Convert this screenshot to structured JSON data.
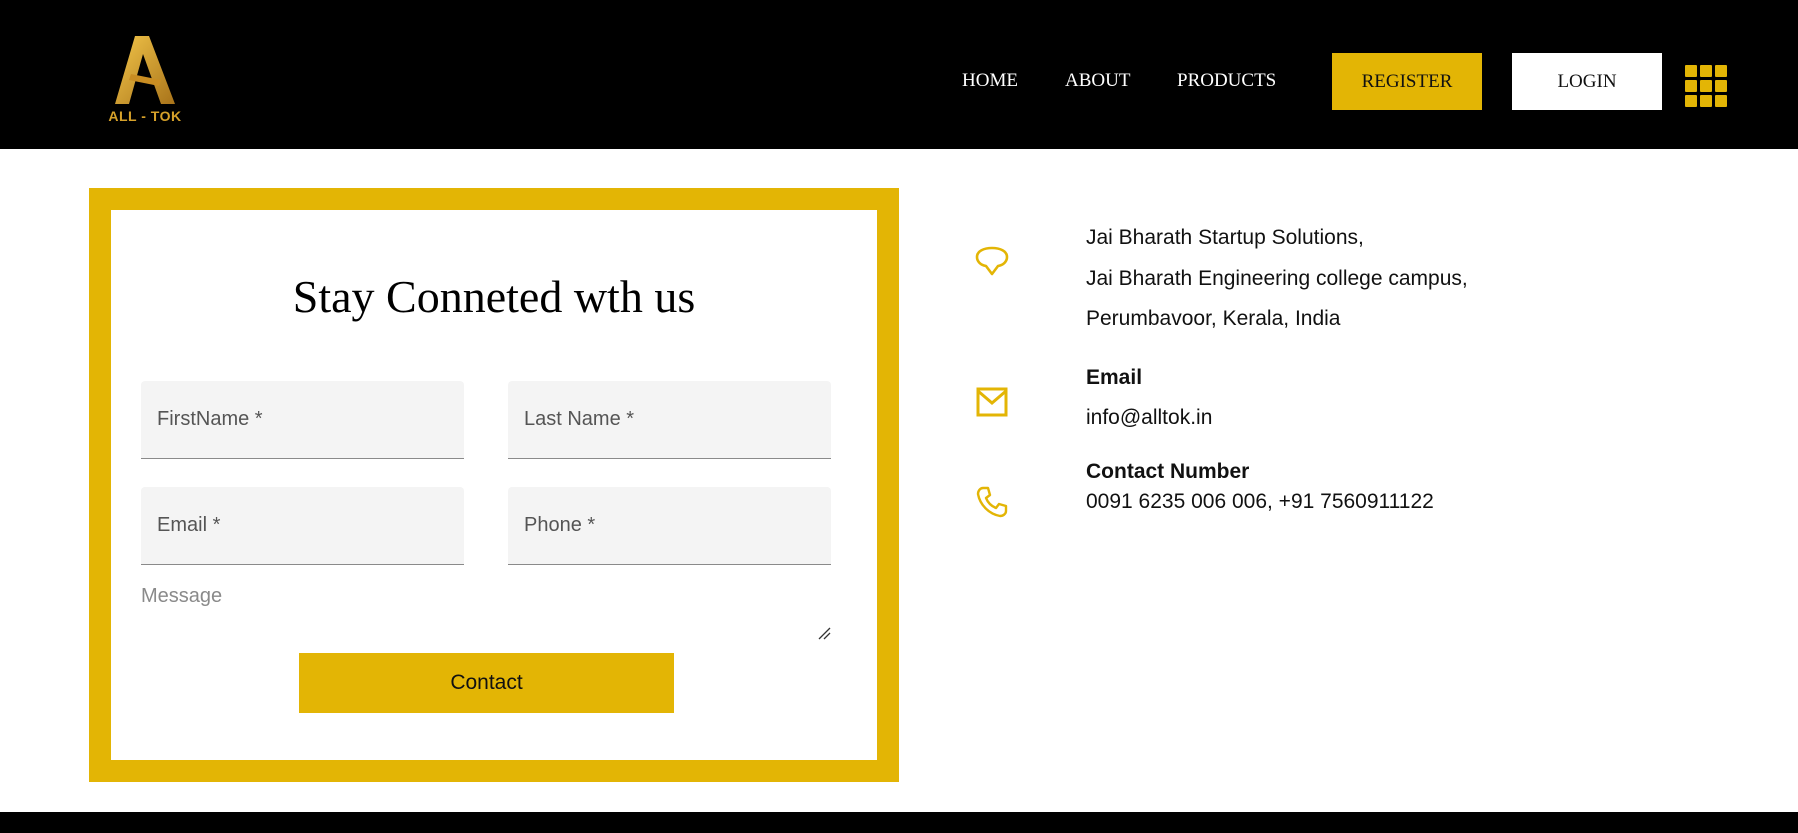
{
  "brand": {
    "logo_text": "ALL - TOK",
    "accent": "#e3b505",
    "logo_gold": "#d6a12a"
  },
  "nav": {
    "links": [
      "HOME",
      "ABOUT",
      "PRODUCTS"
    ],
    "register_label": "REGISTER",
    "login_label": "LOGIN",
    "menu_icon": "grid-menu-icon"
  },
  "form": {
    "title": "Stay Conneted wth us",
    "first_name_placeholder": "FirstName *",
    "last_name_placeholder": "Last Name *",
    "email_placeholder": "Email *",
    "phone_placeholder": "Phone *",
    "message_placeholder": "Message",
    "submit_label": "Contact"
  },
  "contact": {
    "address_lines": [
      "Jai Bharath Startup Solutions,",
      "Jai Bharath Engineering college campus,",
      "Perumbavoor, Kerala, India"
    ],
    "address_icon": "location-pin-icon",
    "email_heading": "Email",
    "email_value": "info@alltok.in",
    "email_icon": "mail-icon",
    "phone_heading": "Contact Number",
    "phone_value": "0091 6235 006 006, +91 7560911122",
    "phone_icon": "phone-icon"
  }
}
